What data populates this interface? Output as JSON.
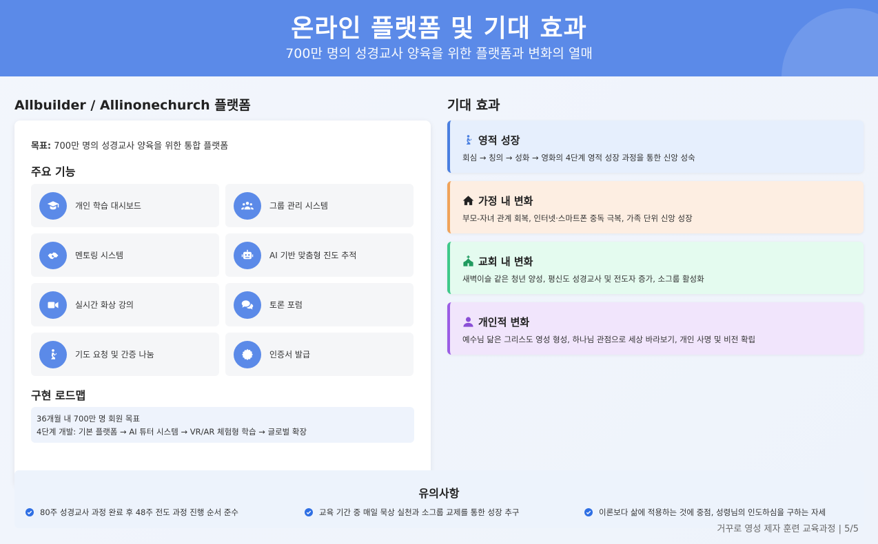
{
  "header": {
    "title": "온라인 플랫폼 및 기대 효과",
    "subtitle": "700만 명의 성경교사 양육을 위한 플랫폼과 변화의 열매"
  },
  "platform": {
    "section_title": "Allbuilder / Allinonechurch 플랫폼",
    "goal_label": "목표:",
    "goal_text": " 700만 명의 성경교사 양육을 위한 통합 플랫폼",
    "features_title": "주요 기능",
    "features": [
      {
        "label": "개인 학습 대시보드",
        "icon": "graduate-icon"
      },
      {
        "label": "그룹 관리 시스템",
        "icon": "users-icon"
      },
      {
        "label": "멘토링 시스템",
        "icon": "handshake-icon"
      },
      {
        "label": "AI 기반 맞춤형 진도 추적",
        "icon": "robot-icon"
      },
      {
        "label": "실시간 화상 강의",
        "icon": "video-icon"
      },
      {
        "label": "토론 포럼",
        "icon": "comments-icon"
      },
      {
        "label": "기도 요청 및 간증 나눔",
        "icon": "praying-icon"
      },
      {
        "label": "인증서 발급",
        "icon": "certificate-icon"
      }
    ],
    "roadmap_title": "구현 로드맵",
    "roadmap_lines": [
      "36개월 내 700만 명 회원 목표",
      "4단계 개발: 기본 플랫폼 → AI 튜터 시스템 → VR/AR 체험형 학습 → 글로벌 확장"
    ]
  },
  "effects": {
    "section_title": "기대 효과",
    "items": [
      {
        "title": "영적 성장",
        "desc": "회심 → 칭의 → 성화 → 영화의 4단계 영적 성장 과정을 통한 신앙 성숙",
        "icon": "praying-icon",
        "accent": "#4a7fe0",
        "bg": "#e6effd"
      },
      {
        "title": "가정 내 변화",
        "desc": "부모-자녀 관계 회복, 인터넷·스마트폰 중독 극복, 가족 단위 신앙 성장",
        "icon": "home-icon",
        "accent": "#f0a35a",
        "bg": "#fdeee2"
      },
      {
        "title": "교회 내 변화",
        "desc": "새벽이슬 같은 청년 양성, 평신도 성경교사 및 전도자 증가, 소그룹 활성화",
        "icon": "church-icon",
        "accent": "#3fc98a",
        "bg": "#e4fbef"
      },
      {
        "title": "개인적 변화",
        "desc": "예수님 닮은 그리스도 영성 형성, 하나님 관점으로 세상 바라보기, 개인 사명 및 비전 확립",
        "icon": "user-icon",
        "accent": "#9b5de5",
        "bg": "#f1e5fc"
      }
    ]
  },
  "notice": {
    "title": "유의사항",
    "items": [
      "80주 성경교사 과정 완료 후 48주 전도 과정 진행 순서 준수",
      "교육 기간 중 매일 묵상 실천과 소그룹 교제를 통한 성장 추구",
      "이론보다 삶에 적용하는 것에 중점, 성령님의 인도하심을 구하는 자세"
    ]
  },
  "footer": "거꾸로 영성 제자 훈련 교육과정 | 5/5"
}
